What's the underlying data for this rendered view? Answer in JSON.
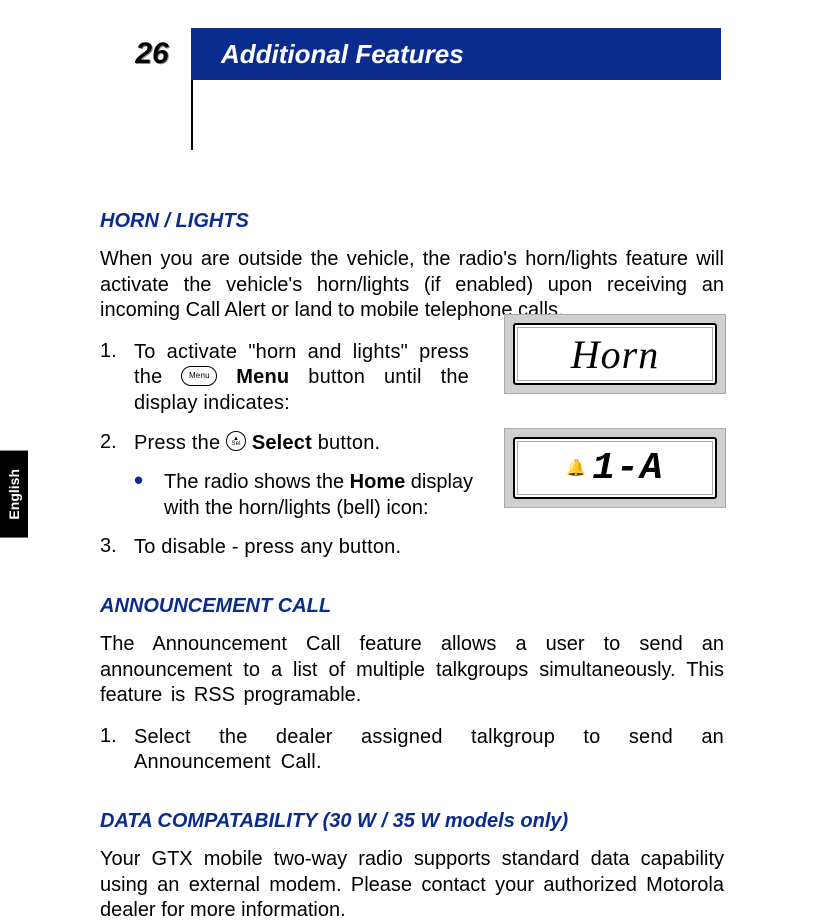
{
  "header": {
    "page_number": "26",
    "title": "Additional Features"
  },
  "side_tab": "English",
  "sections": {
    "horn": {
      "heading": "HORN / LIGHTS",
      "intro": "When you are outside the vehicle, the radio's horn/lights feature will activate the vehicle's horn/lights (if enabled) upon receiving an incoming Call Alert or land to mobile telephone calls.",
      "step1_a": "To activate \"horn and lights\" press the ",
      "step1_menu_icon_label": "Menu",
      "step1_b": " button until the display indicates:",
      "step1_menu_bold": "Menu",
      "step2_a": "Press the ",
      "step2_b": " button.",
      "step2_select_bold": "Select",
      "bullet_a": "The radio shows the ",
      "bullet_home_bold": "Home",
      "bullet_b": " display with the horn/lights (bell) icon:",
      "step3": "To disable - press any button."
    },
    "announcement": {
      "heading": "ANNOUNCEMENT CALL",
      "intro": "The Announcement Call feature allows a user to send an announcement to a list of multiple talkgroups simultaneously. This feature is RSS programable.",
      "step1": "Select the dealer assigned talkgroup to send an Announcement Call."
    },
    "data": {
      "heading": "DATA COMPATABILITY (30 W / 35 W models only)",
      "intro": "Your GTX mobile two-way radio supports standard data capability using an external modem. Please contact your authorized Motorola dealer for more information."
    }
  },
  "displays": {
    "d1": "Horn",
    "d2": "1-A"
  }
}
